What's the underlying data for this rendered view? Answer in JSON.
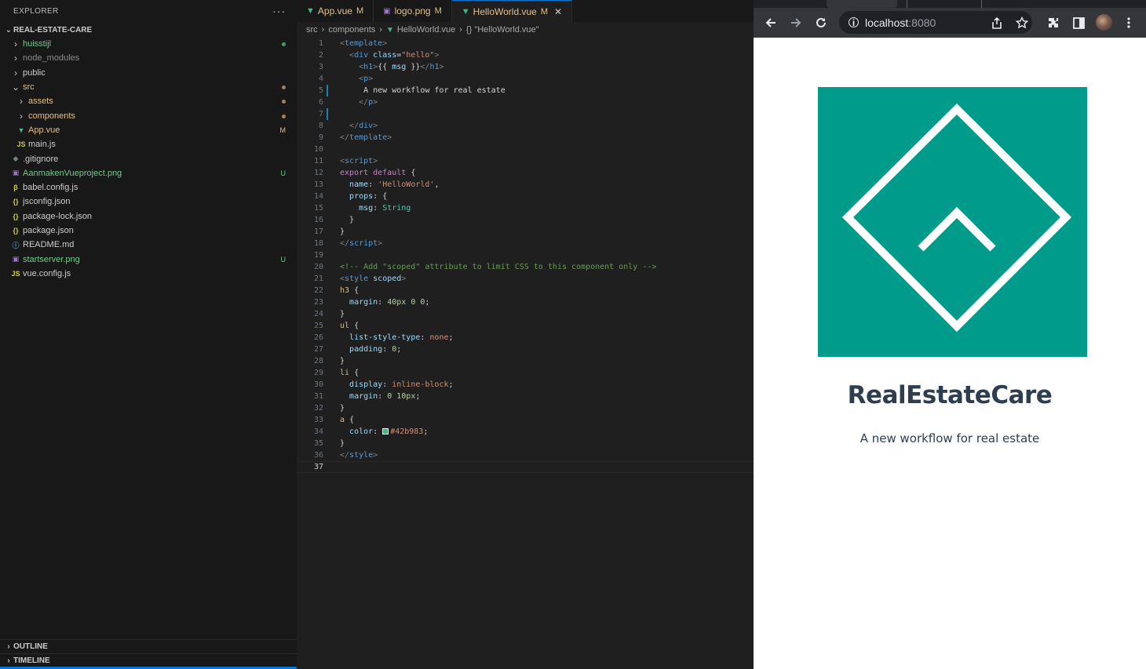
{
  "explorer": {
    "title": "EXPLORER",
    "more": "···",
    "project": "REAL-ESTATE-CARE",
    "items": [
      {
        "label": "huisstijl",
        "kind": "folder",
        "depth": 1,
        "open": false,
        "color": "#73c991",
        "badge": "dot",
        "badgeColor": "#4e9a6a"
      },
      {
        "label": "node_modules",
        "kind": "folder",
        "depth": 1,
        "open": false,
        "color": "#8c8c8c",
        "badge": "",
        "badgeColor": ""
      },
      {
        "label": "public",
        "kind": "folder",
        "depth": 1,
        "open": false,
        "color": "#cccccc",
        "badge": "",
        "badgeColor": ""
      },
      {
        "label": "src",
        "kind": "folder",
        "depth": 1,
        "open": true,
        "color": "#e2c08d",
        "badge": "dot",
        "badgeColor": "#a3825a"
      },
      {
        "label": "assets",
        "kind": "folder",
        "depth": 2,
        "open": false,
        "color": "#e2c08d",
        "badge": "dot",
        "badgeColor": "#a3825a"
      },
      {
        "label": "components",
        "kind": "folder",
        "depth": 2,
        "open": false,
        "color": "#e2c08d",
        "badge": "dot",
        "badgeColor": "#a3825a"
      },
      {
        "label": "App.vue",
        "kind": "vue",
        "depth": 2,
        "color": "#e2c08d",
        "badge": "M",
        "badgeColor": "#e2c08d"
      },
      {
        "label": "main.js",
        "kind": "js",
        "depth": 2,
        "color": "#cccccc",
        "badge": "",
        "badgeColor": ""
      },
      {
        "label": ".gitignore",
        "kind": "git",
        "depth": 1,
        "color": "#cccccc",
        "badge": "",
        "badgeColor": ""
      },
      {
        "label": "AanmakenVueproject.png",
        "kind": "img",
        "depth": 1,
        "color": "#73c991",
        "badge": "U",
        "badgeColor": "#73c991"
      },
      {
        "label": "babel.config.js",
        "kind": "babel",
        "depth": 1,
        "color": "#cccccc",
        "badge": "",
        "badgeColor": ""
      },
      {
        "label": "jsconfig.json",
        "kind": "json",
        "depth": 1,
        "color": "#cccccc",
        "badge": "",
        "badgeColor": ""
      },
      {
        "label": "package-lock.json",
        "kind": "json",
        "depth": 1,
        "color": "#cccccc",
        "badge": "",
        "badgeColor": ""
      },
      {
        "label": "package.json",
        "kind": "json",
        "depth": 1,
        "color": "#cccccc",
        "badge": "",
        "badgeColor": ""
      },
      {
        "label": "README.md",
        "kind": "info",
        "depth": 1,
        "color": "#cccccc",
        "badge": "",
        "badgeColor": ""
      },
      {
        "label": "startserver.png",
        "kind": "img",
        "depth": 1,
        "color": "#73c991",
        "badge": "U",
        "badgeColor": "#73c991"
      },
      {
        "label": "vue.config.js",
        "kind": "js",
        "depth": 1,
        "color": "#cccccc",
        "badge": "",
        "badgeColor": ""
      }
    ],
    "outline": "OUTLINE",
    "timeline": "TIMELINE"
  },
  "editor": {
    "tabs": [
      {
        "label": "App.vue",
        "icon": "vue-icon",
        "status": "M",
        "active": false
      },
      {
        "label": "logo.png",
        "icon": "image-icon",
        "status": "M",
        "active": false
      },
      {
        "label": "HelloWorld.vue",
        "icon": "vue-icon",
        "status": "M",
        "active": true
      }
    ],
    "breadcrumb": [
      "src",
      "components",
      "HelloWorld.vue",
      "{} \"HelloWorld.vue\""
    ],
    "current_line": 37,
    "modified_lines": [
      5,
      7
    ],
    "lines": [
      [
        [
          "t-br",
          "<"
        ],
        [
          "t-tag",
          "template"
        ],
        [
          "t-br",
          ">"
        ]
      ],
      [
        [
          "t-plain",
          "  "
        ],
        [
          "t-br",
          "<"
        ],
        [
          "t-tag",
          "div "
        ],
        [
          "t-attr",
          "class"
        ],
        [
          "t-plain",
          "="
        ],
        [
          "t-str",
          "\"hello\""
        ],
        [
          "t-br",
          ">"
        ]
      ],
      [
        [
          "t-plain",
          "    "
        ],
        [
          "t-br",
          "<"
        ],
        [
          "t-tag",
          "h1"
        ],
        [
          "t-br",
          ">"
        ],
        [
          "t-plain",
          "{{ "
        ],
        [
          "t-attr",
          "msg"
        ],
        [
          "t-plain",
          " }}"
        ],
        [
          "t-br",
          "</"
        ],
        [
          "t-tag",
          "h1"
        ],
        [
          "t-br",
          ">"
        ]
      ],
      [
        [
          "t-plain",
          "    "
        ],
        [
          "t-br",
          "<"
        ],
        [
          "t-tag",
          "p"
        ],
        [
          "t-br",
          ">"
        ]
      ],
      [
        [
          "t-plain",
          "     A new workflow for real estate"
        ]
      ],
      [
        [
          "t-plain",
          "    "
        ],
        [
          "t-br",
          "</"
        ],
        [
          "t-tag",
          "p"
        ],
        [
          "t-br",
          ">"
        ]
      ],
      [
        [
          "t-plain",
          ""
        ]
      ],
      [
        [
          "t-plain",
          "  "
        ],
        [
          "t-br",
          "</"
        ],
        [
          "t-tag",
          "div"
        ],
        [
          "t-br",
          ">"
        ]
      ],
      [
        [
          "t-br",
          "</"
        ],
        [
          "t-tag",
          "template"
        ],
        [
          "t-br",
          ">"
        ]
      ],
      [
        [
          "t-plain",
          ""
        ]
      ],
      [
        [
          "t-br",
          "<"
        ],
        [
          "t-tag",
          "script"
        ],
        [
          "t-br",
          ">"
        ]
      ],
      [
        [
          "t-kw",
          "export default "
        ],
        [
          "t-plain",
          "{"
        ]
      ],
      [
        [
          "t-plain",
          "  "
        ],
        [
          "t-attr",
          "name"
        ],
        [
          "t-plain",
          ": "
        ],
        [
          "t-str",
          "'HelloWorld'"
        ],
        [
          "t-plain",
          ","
        ]
      ],
      [
        [
          "t-plain",
          "  "
        ],
        [
          "t-attr",
          "props"
        ],
        [
          "t-plain",
          ": {"
        ]
      ],
      [
        [
          "t-plain",
          "    "
        ],
        [
          "t-attr",
          "msg"
        ],
        [
          "t-plain",
          ": "
        ],
        [
          "t-type",
          "String"
        ]
      ],
      [
        [
          "t-plain",
          "  }"
        ]
      ],
      [
        [
          "t-plain",
          "}"
        ]
      ],
      [
        [
          "t-br",
          "</"
        ],
        [
          "t-tag",
          "script"
        ],
        [
          "t-br",
          ">"
        ]
      ],
      [
        [
          "t-plain",
          ""
        ]
      ],
      [
        [
          "t-cmt",
          "<!-- Add \"scoped\" attribute to limit CSS to this component only -->"
        ]
      ],
      [
        [
          "t-br",
          "<"
        ],
        [
          "t-tag",
          "style "
        ],
        [
          "t-attr",
          "scoped"
        ],
        [
          "t-br",
          ">"
        ]
      ],
      [
        [
          "t-sel",
          "h3"
        ],
        [
          "t-plain",
          " {"
        ]
      ],
      [
        [
          "t-plain",
          "  "
        ],
        [
          "t-prop",
          "margin"
        ],
        [
          "t-plain",
          ": "
        ],
        [
          "t-num",
          "40px 0 0"
        ],
        [
          "t-plain",
          ";"
        ]
      ],
      [
        [
          "t-plain",
          "}"
        ]
      ],
      [
        [
          "t-sel",
          "ul"
        ],
        [
          "t-plain",
          " {"
        ]
      ],
      [
        [
          "t-plain",
          "  "
        ],
        [
          "t-prop",
          "list-style-type"
        ],
        [
          "t-plain",
          ": "
        ],
        [
          "t-str",
          "none"
        ],
        [
          "t-plain",
          ";"
        ]
      ],
      [
        [
          "t-plain",
          "  "
        ],
        [
          "t-prop",
          "padding"
        ],
        [
          "t-plain",
          ": "
        ],
        [
          "t-num",
          "0"
        ],
        [
          "t-plain",
          ";"
        ]
      ],
      [
        [
          "t-plain",
          "}"
        ]
      ],
      [
        [
          "t-sel",
          "li"
        ],
        [
          "t-plain",
          " {"
        ]
      ],
      [
        [
          "t-plain",
          "  "
        ],
        [
          "t-prop",
          "display"
        ],
        [
          "t-plain",
          ": "
        ],
        [
          "t-str",
          "inline-block"
        ],
        [
          "t-plain",
          ";"
        ]
      ],
      [
        [
          "t-plain",
          "  "
        ],
        [
          "t-prop",
          "margin"
        ],
        [
          "t-plain",
          ": "
        ],
        [
          "t-num",
          "0 10px"
        ],
        [
          "t-plain",
          ";"
        ]
      ],
      [
        [
          "t-plain",
          "}"
        ]
      ],
      [
        [
          "t-sel",
          "a"
        ],
        [
          "t-plain",
          " {"
        ]
      ],
      [
        [
          "t-plain",
          "  "
        ],
        [
          "t-prop",
          "color"
        ],
        [
          "t-plain",
          ": "
        ],
        [
          "swatch",
          ""
        ],
        [
          "t-str",
          "#42b983"
        ],
        [
          "t-plain",
          ";"
        ]
      ],
      [
        [
          "t-plain",
          "}"
        ]
      ],
      [
        [
          "t-br",
          "</"
        ],
        [
          "t-tag",
          "style"
        ],
        [
          "t-br",
          ">"
        ]
      ],
      [
        [
          "t-plain",
          ""
        ]
      ]
    ]
  },
  "browser": {
    "url_host": "localhost",
    "url_port": ":8080",
    "app_title": "RealEstateCare",
    "app_tagline": "A new workflow for real estate",
    "logo_color": "#009b8a"
  }
}
